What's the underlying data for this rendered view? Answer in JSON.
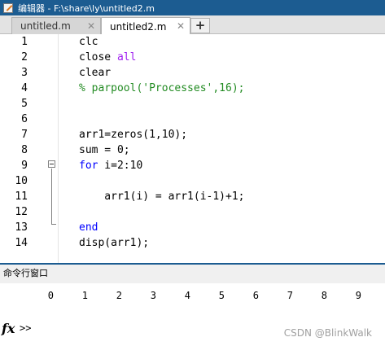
{
  "window": {
    "title": "编辑器 - F:\\share\\ly\\untitled2.m"
  },
  "tabs": [
    {
      "label": "untitled.m",
      "close": "✕"
    },
    {
      "label": "untitled2.m",
      "close": "✕"
    }
  ],
  "add_tab_label": "+",
  "editor": {
    "lines": [
      {
        "no": "1",
        "parts": [
          {
            "t": "clc",
            "c": "plain"
          }
        ]
      },
      {
        "no": "2",
        "parts": [
          {
            "t": "close ",
            "c": "plain"
          },
          {
            "t": "all",
            "c": "str"
          }
        ]
      },
      {
        "no": "3",
        "parts": [
          {
            "t": "clear",
            "c": "plain"
          }
        ]
      },
      {
        "no": "4",
        "parts": [
          {
            "t": "% parpool('Processes',16);",
            "c": "cmt"
          }
        ]
      },
      {
        "no": "5",
        "parts": []
      },
      {
        "no": "6",
        "parts": []
      },
      {
        "no": "7",
        "parts": [
          {
            "t": "arr1=zeros(1,10);",
            "c": "plain"
          }
        ]
      },
      {
        "no": "8",
        "parts": [
          {
            "t": "sum = 0;",
            "c": "plain"
          }
        ]
      },
      {
        "no": "9",
        "parts": [
          {
            "t": "for",
            "c": "kw"
          },
          {
            "t": " i=2:10",
            "c": "plain"
          }
        ]
      },
      {
        "no": "10",
        "parts": []
      },
      {
        "no": "11",
        "parts": [
          {
            "t": "    arr1(i) = arr1(i-1)+1;",
            "c": "plain"
          }
        ]
      },
      {
        "no": "12",
        "parts": []
      },
      {
        "no": "13",
        "parts": [
          {
            "t": "end",
            "c": "kw"
          }
        ]
      },
      {
        "no": "14",
        "parts": [
          {
            "t": "disp(arr1);",
            "c": "plain"
          }
        ]
      }
    ]
  },
  "command_window": {
    "title": "命令行窗口",
    "output": [
      "0",
      "1",
      "2",
      "3",
      "4",
      "5",
      "6",
      "7",
      "8",
      "9"
    ],
    "fx_label": "fx",
    "prompt": ">>"
  },
  "watermark": "CSDN @BlinkWalk",
  "colors": {
    "keyword": "#0000ff",
    "string": "#a020f0",
    "comment": "#228b22",
    "accent": "#1c5c91"
  }
}
